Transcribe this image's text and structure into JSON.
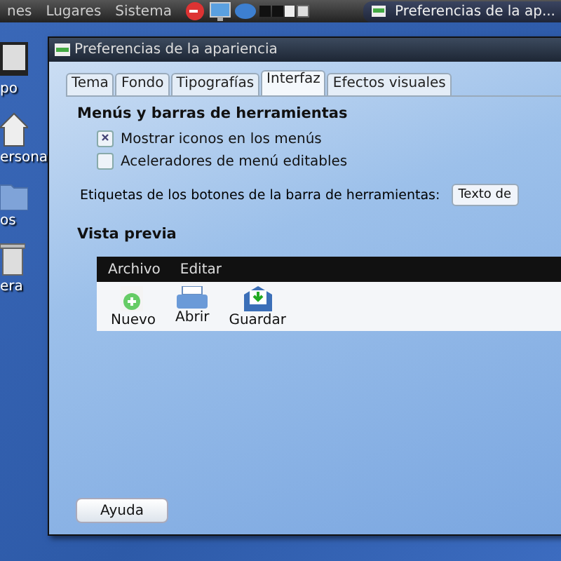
{
  "top_panel": {
    "menus": [
      "nes",
      "Lugares",
      "Sistema"
    ],
    "task_button": {
      "title": "Preferencias de la ap..."
    }
  },
  "desktop_icons": [
    {
      "label": "po",
      "kind": "computer"
    },
    {
      "label": "ersona",
      "kind": "home"
    },
    {
      "label": "os",
      "kind": "folder"
    },
    {
      "label": "era",
      "kind": "trash"
    }
  ],
  "window": {
    "title": "Preferencias de la apariencia",
    "tabs": [
      {
        "label": "Tema",
        "selected": false
      },
      {
        "label": "Fondo",
        "selected": false
      },
      {
        "label": "Tipografías",
        "selected": false
      },
      {
        "label": "Interfaz",
        "selected": true
      },
      {
        "label": "Efectos visuales",
        "selected": false
      }
    ],
    "section_title": "Menús y barras de herramientas",
    "options": [
      {
        "label": "Mostrar iconos en los menús",
        "checked": true
      },
      {
        "label": "Aceleradores de menú editables",
        "checked": false
      }
    ],
    "toolbar_labels": {
      "label": "Etiquetas de los botones de la barra de herramientas:",
      "value": "Texto de"
    },
    "preview": {
      "title": "Vista previa",
      "menus": [
        "Archivo",
        "Editar"
      ],
      "tools": [
        {
          "label": "Nuevo",
          "kind": "new"
        },
        {
          "label": "Abrir",
          "kind": "open"
        },
        {
          "label": "Guardar",
          "kind": "save"
        }
      ]
    },
    "help_button": "Ayuda"
  }
}
